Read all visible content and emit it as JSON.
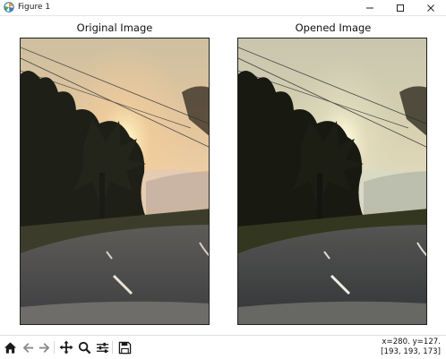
{
  "window": {
    "title": "Figure 1",
    "icon": "matplotlib-figure-icon",
    "controls": [
      "minimize-icon",
      "maximize-icon",
      "close-icon"
    ]
  },
  "figure": {
    "panels": [
      {
        "title": "Original Image",
        "image": "sunset-road-original"
      },
      {
        "title": "Opened Image",
        "image": "sunset-road-opened"
      }
    ]
  },
  "toolbar": {
    "tools": [
      "home-icon",
      "back-arrow-icon",
      "forward-arrow-icon",
      "pan-icon",
      "zoom-icon",
      "configure-subplots-icon",
      "save-icon"
    ]
  },
  "status": {
    "coords": "x=280. y=127.",
    "pixel": "[193, 193, 173]"
  }
}
